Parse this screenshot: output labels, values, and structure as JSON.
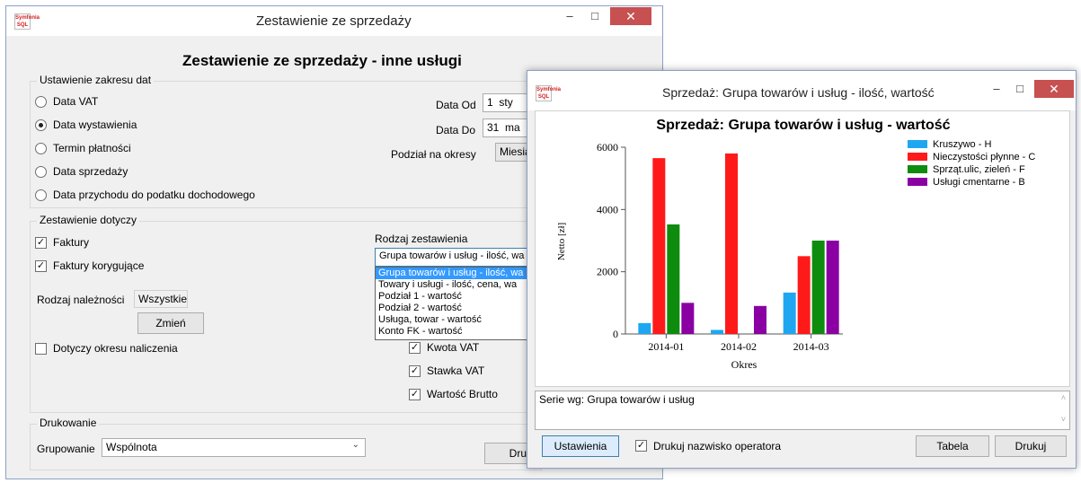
{
  "main_window": {
    "title": "Zestawienie ze sprzedaży",
    "heading": "Zestawienie ze sprzedaży - inne usługi",
    "app_icon_text": "Symfonia SQL",
    "btn_min": "–",
    "btn_max": "□",
    "btn_close": "✕",
    "date_range": {
      "label": "Ustawienie zakresu dat",
      "options": [
        "Data VAT",
        "Data wystawienia",
        "Termin płatności",
        "Data sprzedaży",
        "Data przychodu do podatku dochodowego"
      ],
      "date_from_label": "Data Od",
      "date_from_day": "1",
      "date_from_month": "sty",
      "date_to_label": "Data Do",
      "date_to_day": "31",
      "date_to_month": "ma",
      "period_label": "Podział na okresy",
      "period_value": "Miesią"
    },
    "applies": {
      "label": "Zestawienie dotyczy",
      "invoices": "Faktury",
      "corrections": "Faktury korygujące",
      "receivable_label": "Rodzaj należności",
      "receivable_value": "Wszystkie",
      "change_button": "Zmień",
      "accrual_period": "Dotyczy okresu naliczenia"
    },
    "report_type": {
      "label": "Rodzaj zestawienia",
      "selected": "Grupa towarów i usług - ilość, wa",
      "options": [
        "Grupa towarów i usług - ilość, wa",
        "Towary i usługi - ilość, cena, wa",
        "Podział 1 - wartość",
        "Podział 2 - wartość",
        "Usługa, towar - wartość",
        "Konto FK - wartość"
      ],
      "checks": [
        "Kwota VAT",
        "Stawka VAT",
        "Wartość Brutto"
      ]
    },
    "print": {
      "label": "Drukowanie",
      "grouping_label": "Grupowanie",
      "grouping_value": "Wspólnota",
      "print_button": "Druk"
    }
  },
  "chart_window": {
    "title": "Sprzedaż: Grupa towarów i usług - ilość, wartość",
    "app_icon_text": "Symfonia SQL",
    "btn_min": "–",
    "btn_max": "□",
    "btn_close": "✕",
    "series_text": "Serie wg: Grupa towarów i usług",
    "settings_button": "Ustawienia",
    "print_operator_label": "Drukuj nazwisko operatora",
    "table_button": "Tabela",
    "print_button": "Drukuj"
  },
  "chart_data": {
    "type": "bar",
    "title": "Sprzedaż: Grupa towarów i usług - wartość",
    "xlabel": "Okres",
    "ylabel": "Netto [zł]",
    "ylim": [
      0,
      6000
    ],
    "yticks": [
      "0",
      "2000",
      "4000",
      "6000"
    ],
    "categories": [
      "2014-01",
      "2014-02",
      "2014-03"
    ],
    "series": [
      {
        "name": "Kruszywo - H",
        "color": "#1ea7f0",
        "values": [
          350,
          130,
          1330
        ]
      },
      {
        "name": "Nieczystości płynne - C",
        "color": "#ff1a1a",
        "values": [
          5650,
          5800,
          2500
        ]
      },
      {
        "name": "Sprząt.ulic, zieleń - F",
        "color": "#0e8c0e",
        "values": [
          3520,
          0,
          3000
        ]
      },
      {
        "name": "Usługi cmentarne - B",
        "color": "#8a00a3",
        "values": [
          1000,
          900,
          3000
        ]
      }
    ],
    "legend": "right",
    "grid": false
  }
}
